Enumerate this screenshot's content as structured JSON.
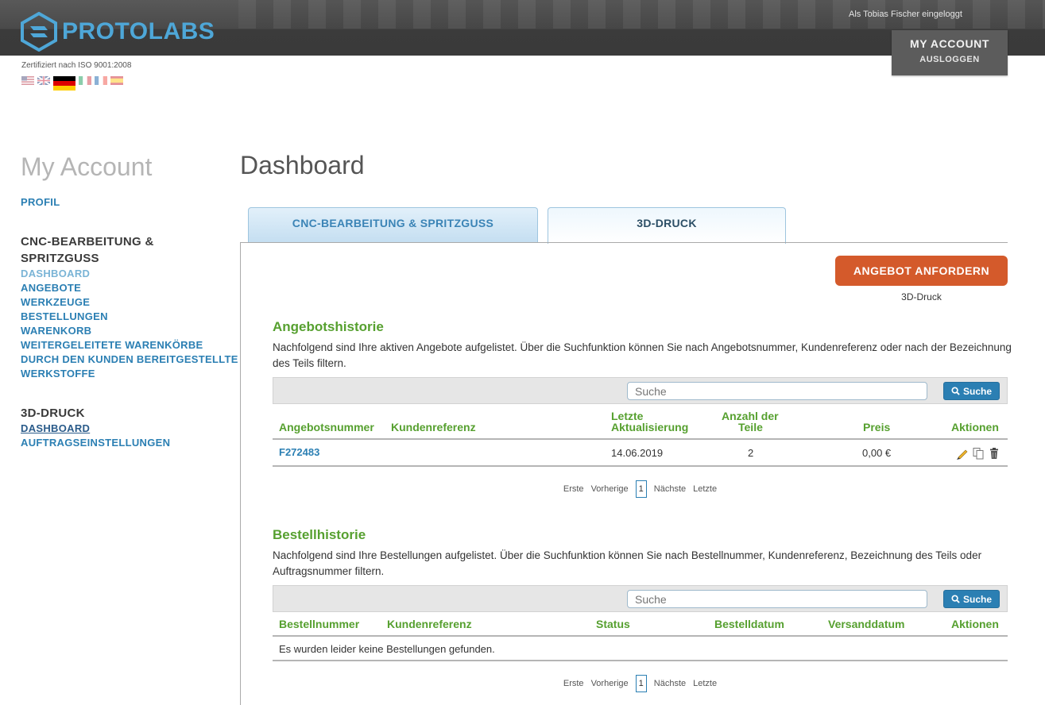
{
  "header": {
    "brand": "PROTOLABS",
    "login_status": "Als Tobias Fischer eingeloggt",
    "my_account": "MY ACCOUNT",
    "logout": "AUSLOGGEN",
    "iso": "Zertifiziert nach ISO 9001:2008",
    "brand_color": "#4ea7d8"
  },
  "sidebar": {
    "title": "My Account",
    "profile": "PROFIL",
    "cnc_heading_line1": "CNC-BEARBEITUNG &",
    "cnc_heading_line2": "SPRITZGUSS",
    "cnc_items": [
      "DASHBOARD",
      "ANGEBOTE",
      "WERKZEUGE",
      "BESTELLUNGEN",
      "WARENKORB",
      "WEITERGELEITETE WARENKÖRBE",
      "DURCH DEN KUNDEN BEREITGESTELLTE",
      "WERKSTOFFE"
    ],
    "print_heading": "3D-DRUCK",
    "print_items": [
      "DASHBOARD",
      "AUFTRAGSEINSTELLUNGEN"
    ]
  },
  "main": {
    "title": "Dashboard",
    "tabs": [
      "CNC-BEARBEITUNG & SPRITZGUSS",
      "3D-DRUCK"
    ],
    "quote_button": "ANGEBOT ANFORDERN",
    "quote_sub": "3D-Druck",
    "accent_color": "#d45a2b"
  },
  "quotes": {
    "title": "Angebotshistorie",
    "desc": "Nachfolgend sind Ihre aktiven Angebote aufgelistet. Über die Suchfunktion können Sie nach Angebotsnummer, Kundenreferenz oder nach der Bezeichnung des Teils filtern.",
    "search_placeholder": "Suche",
    "search_button": "Suche",
    "columns": {
      "number": "Angebotsnummer",
      "reference": "Kundenreferenz",
      "updated_1": "Letzte",
      "updated_2": "Aktualisierung",
      "count_1": "Anzahl der",
      "count_2": "Teile",
      "price": "Preis",
      "actions": "Aktionen"
    },
    "rows": [
      {
        "number": "F272483",
        "reference": "",
        "updated": "14.06.2019",
        "count": "2",
        "price": "0,00 €"
      }
    ],
    "pager": {
      "first": "Erste",
      "prev": "Vorherige",
      "current": "1",
      "next": "Nächste",
      "last": "Letzte"
    }
  },
  "orders": {
    "title": "Bestellhistorie",
    "desc": "Nachfolgend sind Ihre Bestellungen aufgelistet. Über die Suchfunktion können Sie nach Bestellnummer, Kundenreferenz, Bezeichnung des Teils oder Auftragsnummer filtern.",
    "search_placeholder": "Suche",
    "search_button": "Suche",
    "columns": {
      "number": "Bestellnummer",
      "reference": "Kundenreferenz",
      "status": "Status",
      "order_date": "Bestelldatum",
      "ship_date": "Versanddatum",
      "actions": "Aktionen"
    },
    "empty": "Es wurden leider keine Bestellungen gefunden.",
    "pager": {
      "first": "Erste",
      "prev": "Vorherige",
      "current": "1",
      "next": "Nächste",
      "last": "Letzte"
    }
  }
}
